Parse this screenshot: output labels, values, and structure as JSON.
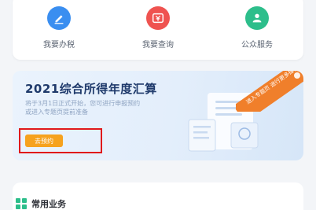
{
  "quick_services": [
    {
      "label": "我要办税",
      "icon": "pen-icon",
      "color": "#3a8ef0"
    },
    {
      "label": "我要查询",
      "icon": "money-icon",
      "color": "#ef5350"
    },
    {
      "label": "公众服务",
      "icon": "people-icon",
      "color": "#2dbe8b"
    }
  ],
  "banner": {
    "title": "2021综合所得年度汇算",
    "description": "将于3月1日正式开始，您可进行申报预约或进入专题页提前准备",
    "button_label": "去预约",
    "ribbon_text": "进入专题页 进行更多操作"
  },
  "common": {
    "title": "常用业务",
    "icon": "grid-icon"
  },
  "colors": {
    "accent_blue": "#3a8ef0",
    "accent_red": "#ef5350",
    "accent_green": "#2dbe8b",
    "button_orange": "#f6a21e",
    "highlight_red": "#e0191b",
    "ribbon_orange": "#f07f2b",
    "common_icon_green": "#2dbe8b"
  }
}
